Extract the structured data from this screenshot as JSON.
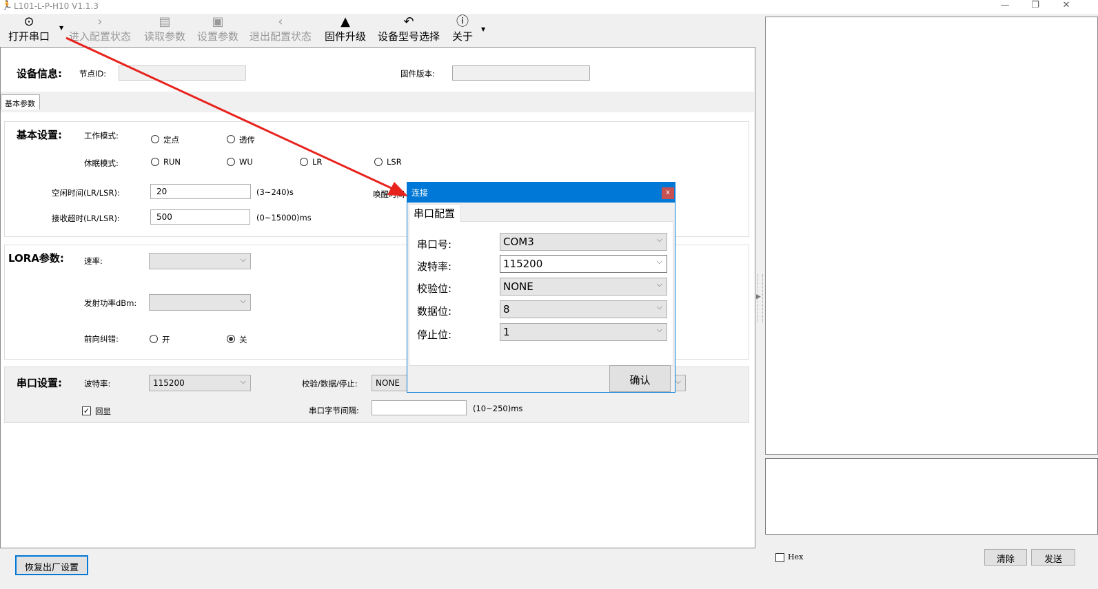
{
  "window": {
    "title": "L101-L-P-H10 V1.1.3",
    "controls": [
      "—",
      "❐",
      "✕"
    ]
  },
  "toolbar": {
    "items": [
      {
        "label": "打开串口",
        "icon": "location-check-icon",
        "enabled": true
      },
      {
        "label": "进入配置状态",
        "icon": "chevron-right-icon",
        "enabled": false
      },
      {
        "label": "读取参数",
        "icon": "document-search-icon",
        "enabled": false
      },
      {
        "label": "设置参数",
        "icon": "save-icon",
        "enabled": false
      },
      {
        "label": "退出配置状态",
        "icon": "chevron-left-icon",
        "enabled": false
      },
      {
        "label": "固件升级",
        "icon": "rocket-icon",
        "enabled": true
      },
      {
        "label": "设备型号选择",
        "icon": "undo-arrow-icon",
        "enabled": true
      },
      {
        "label": "关于",
        "icon": "info-icon",
        "enabled": true
      }
    ]
  },
  "device_info": {
    "heading": "设备信息:",
    "node_id_label": "节点ID:",
    "node_id": "",
    "firmware_label": "固件版本:",
    "firmware": ""
  },
  "tab": "基本参数",
  "basic": {
    "heading": "基本设置:",
    "work_mode_label": "工作模式:",
    "work_modes": [
      "定点",
      "透传"
    ],
    "sleep_mode_label": "休眠模式:",
    "sleep_modes": [
      "RUN",
      "WU",
      "LR",
      "LSR"
    ],
    "idle_label": "空闲时间(LR/LSR):",
    "idle_value": "20",
    "idle_range": "(3~240)s",
    "recv_label": "接收超时(LR/LSR):",
    "recv_value": "500",
    "recv_range": "(0~15000)ms",
    "wake_label": "唤醒时间"
  },
  "lora": {
    "heading": "LORA参数:",
    "rate_label": "速率:",
    "rate": "",
    "power_label": "发射功率dBm:",
    "power": "",
    "fec_label": "前向纠错:",
    "fec_on": "开",
    "fec_off": "关",
    "fec_selected": "关"
  },
  "serial": {
    "heading": "串口设置:",
    "baud_label": "波特率:",
    "baud": "115200",
    "parity_label": "校验/数据/停止:",
    "parity": "NONE",
    "echo_label": "回显",
    "echo_checked": true,
    "interval_label": "串口字节间隔:",
    "interval": "",
    "interval_range": "(10~250)ms"
  },
  "restore_button": "恢复出厂设置",
  "right": {
    "hex_label": "Hex",
    "clear_button": "清除",
    "send_button": "发送"
  },
  "dialog": {
    "title": "连接",
    "close": "x",
    "tab": "串口配置",
    "fields": [
      {
        "label": "串口号:",
        "value": "COM3"
      },
      {
        "label": "波特率:",
        "value": "115200"
      },
      {
        "label": "校验位:",
        "value": "NONE"
      },
      {
        "label": "数据位:",
        "value": "8"
      },
      {
        "label": "停止位:",
        "value": "1"
      }
    ],
    "confirm_button": "确认"
  },
  "colors": {
    "dialog_title": "#0078d7",
    "close_button": "#c75050",
    "arrow": "#e8231e"
  }
}
